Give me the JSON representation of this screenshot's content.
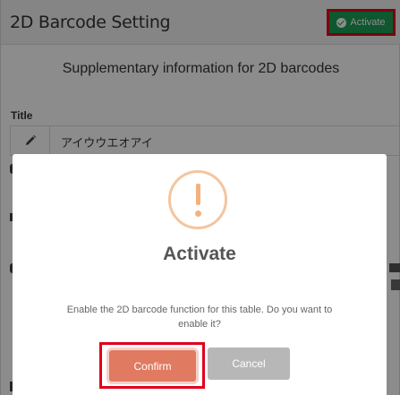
{
  "header": {
    "title": "2D Barcode Setting",
    "activate_label": "Activate"
  },
  "main": {
    "supplementary_text": "Supplementary information for 2D barcodes",
    "title_label": "Title",
    "title_value": "アイウウエオアイ"
  },
  "dialog": {
    "title": "Activate",
    "message_line1": "Enable the 2D barcode function for this table. Do you want to",
    "message_line2": "enable it?",
    "confirm_label": "Confirm",
    "cancel_label": "Cancel"
  },
  "colors": {
    "activate_bg": "#1b9e57",
    "highlight_border": "#e0001a",
    "confirm_bg": "#e07a61",
    "cancel_bg": "#b7b7b7",
    "warning_icon": "#f2b27c"
  },
  "icons": {
    "activate": "check-circle-icon",
    "title_edit": "pencil-icon",
    "dialog": "warning-icon"
  }
}
